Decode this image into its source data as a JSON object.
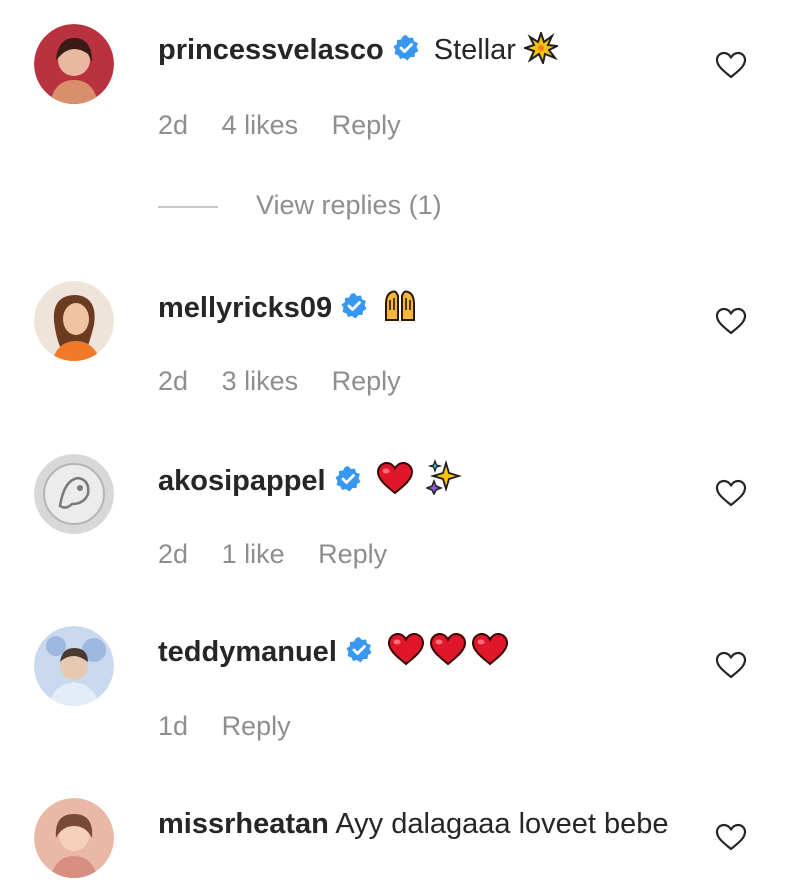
{
  "comments": [
    {
      "username": "princessvelasco",
      "verified": true,
      "text": "Stellar",
      "emojis": [
        "collision-emoji"
      ],
      "time": "2d",
      "likes": "4 likes",
      "reply": "Reply",
      "view_replies": "View replies (1)"
    },
    {
      "username": "mellyricks09",
      "verified": true,
      "text": "",
      "emojis": [
        "raising-hands-emoji"
      ],
      "time": "2d",
      "likes": "3 likes",
      "reply": "Reply"
    },
    {
      "username": "akosipappel",
      "verified": true,
      "text": "",
      "emojis": [
        "red-heart-emoji",
        "sparkles-emoji"
      ],
      "time": "2d",
      "likes": "1 like",
      "reply": "Reply"
    },
    {
      "username": "teddymanuel",
      "verified": true,
      "text": "",
      "emojis": [
        "red-heart-emoji",
        "red-heart-emoji",
        "red-heart-emoji"
      ],
      "time": "1d",
      "reply": "Reply"
    },
    {
      "username": "missrheatan",
      "verified": false,
      "text": "Ayy dalagaaa loveet bebe"
    }
  ],
  "colors": {
    "verified_blue": "#3897f0",
    "meta_gray": "#8e8e8e",
    "text_dark": "#262626",
    "heart_red": "#e0162b"
  }
}
